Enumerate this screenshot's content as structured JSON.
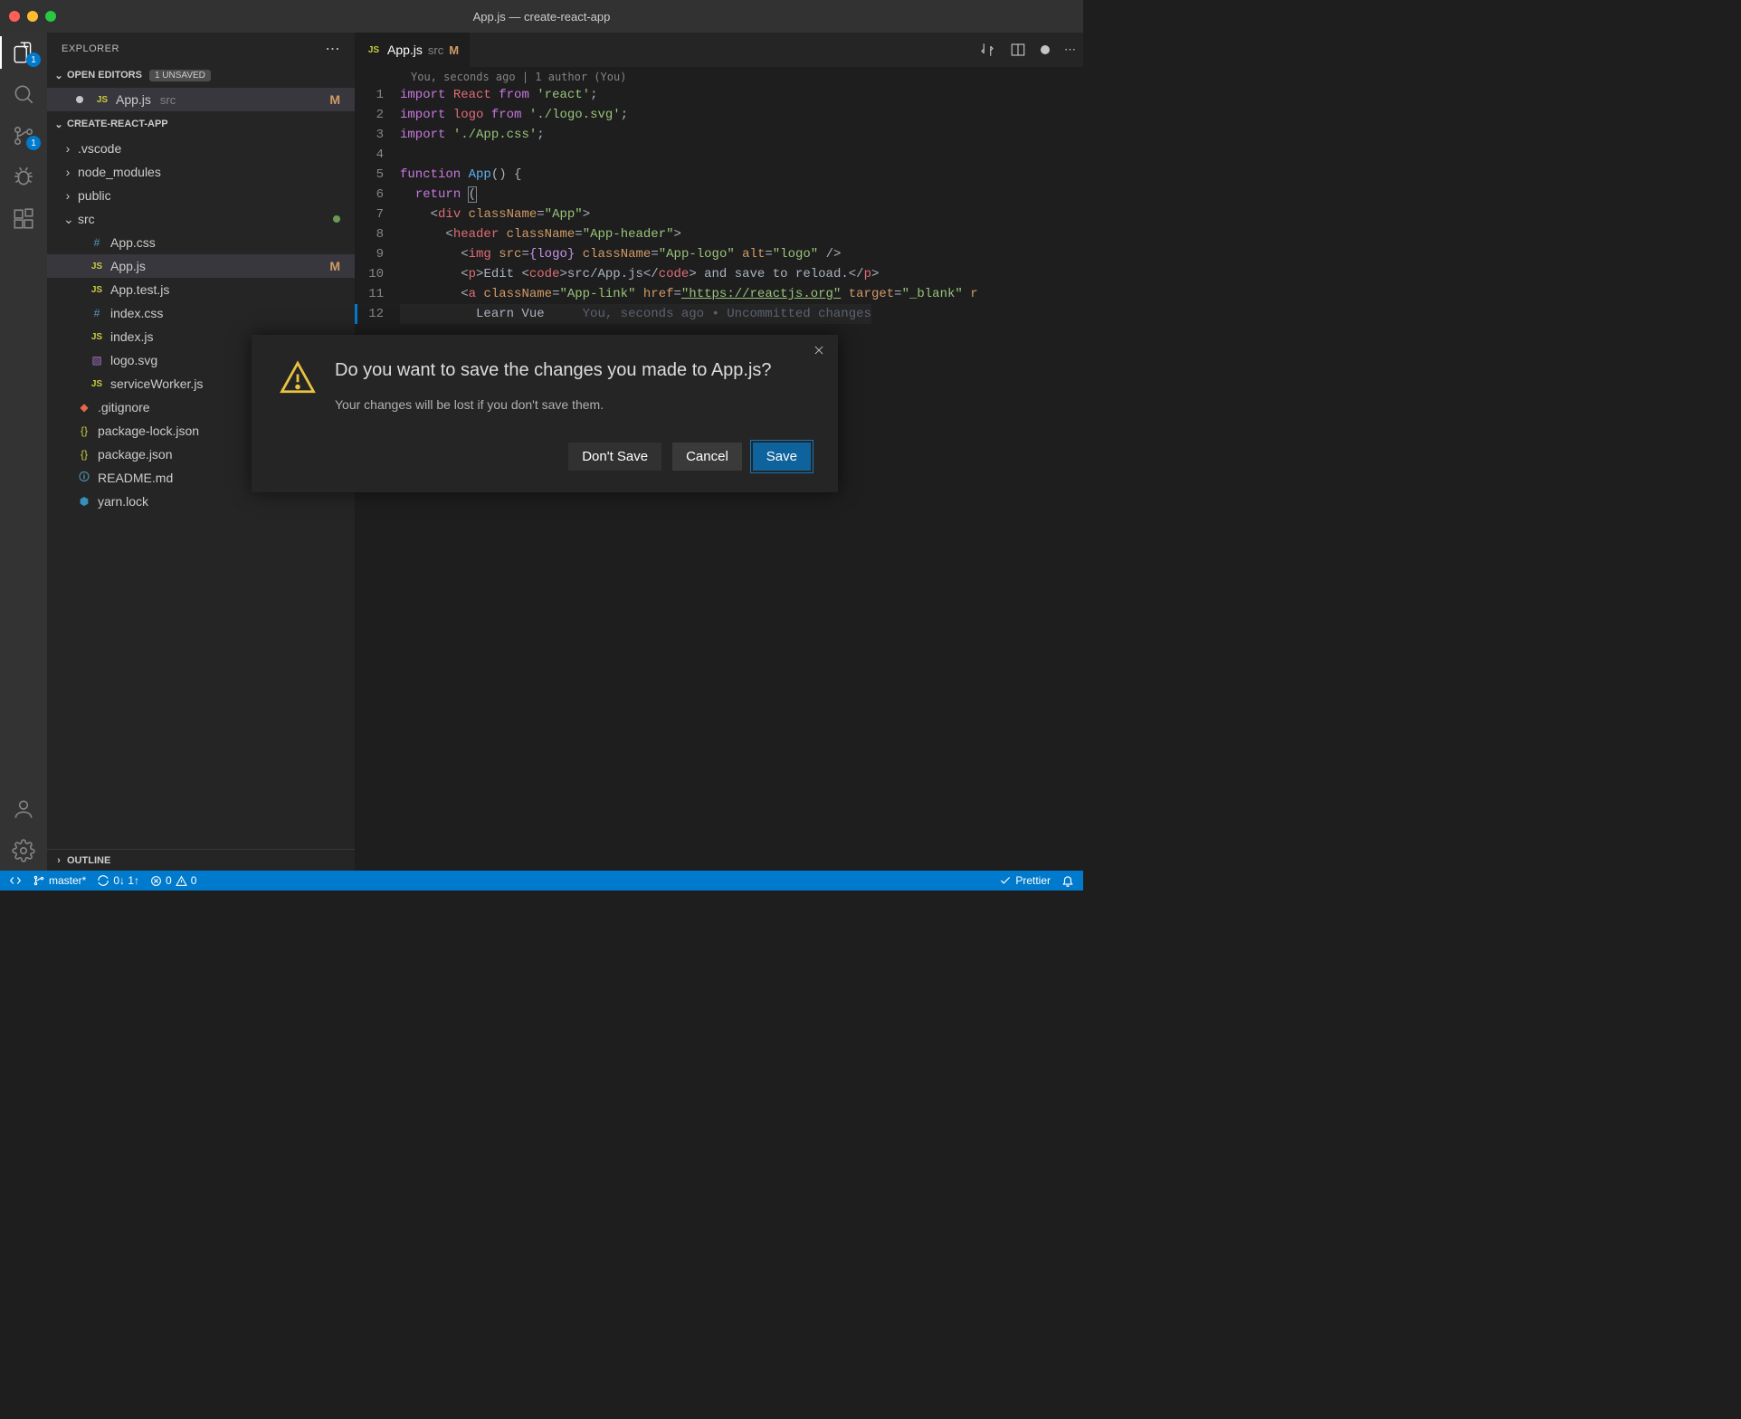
{
  "window": {
    "title": "App.js — create-react-app"
  },
  "activity": {
    "explorer_badge": "1",
    "scm_badge": "1"
  },
  "sidebar": {
    "title": "EXPLORER",
    "openEditors": {
      "label": "OPEN EDITORS",
      "unsaved": "1 UNSAVED",
      "items": [
        {
          "name": "App.js",
          "path": "src",
          "mod": "M",
          "dirty": true,
          "icon": "js"
        }
      ]
    },
    "project": {
      "label": "CREATE-REACT-APP",
      "tree": [
        {
          "type": "folder",
          "name": ".vscode",
          "expanded": false,
          "indent": 1
        },
        {
          "type": "folder",
          "name": "node_modules",
          "expanded": false,
          "indent": 1
        },
        {
          "type": "folder",
          "name": "public",
          "expanded": false,
          "indent": 1
        },
        {
          "type": "folder",
          "name": "src",
          "expanded": true,
          "indent": 1,
          "untracked": true
        },
        {
          "type": "file",
          "name": "App.css",
          "icon": "css",
          "indent": 2
        },
        {
          "type": "file",
          "name": "App.js",
          "icon": "js",
          "indent": 2,
          "active": true,
          "mod": "M"
        },
        {
          "type": "file",
          "name": "App.test.js",
          "icon": "js",
          "indent": 2
        },
        {
          "type": "file",
          "name": "index.css",
          "icon": "css",
          "indent": 2
        },
        {
          "type": "file",
          "name": "index.js",
          "icon": "js",
          "indent": 2
        },
        {
          "type": "file",
          "name": "logo.svg",
          "icon": "svg",
          "indent": 2
        },
        {
          "type": "file",
          "name": "serviceWorker.js",
          "icon": "js",
          "indent": 2
        },
        {
          "type": "file",
          "name": ".gitignore",
          "icon": "git",
          "indent": 1
        },
        {
          "type": "file",
          "name": "package-lock.json",
          "icon": "json",
          "indent": 1
        },
        {
          "type": "file",
          "name": "package.json",
          "icon": "json",
          "indent": 1
        },
        {
          "type": "file",
          "name": "README.md",
          "icon": "md",
          "indent": 1
        },
        {
          "type": "file",
          "name": "yarn.lock",
          "icon": "yarn",
          "indent": 1
        }
      ]
    },
    "outline": {
      "label": "OUTLINE"
    }
  },
  "editor": {
    "tab": {
      "icon": "js",
      "name": "App.js",
      "path": "src",
      "mod": "M"
    },
    "codelens": "You, seconds ago | 1 author (You)",
    "blame": "You, seconds ago • Uncommitted changes",
    "code": {
      "l1_import": "import",
      "l1_react": "React",
      "l1_from": "from",
      "l1_str": "'react'",
      "l2_import": "import",
      "l2_logo": "logo",
      "l2_from": "from",
      "l2_str": "'./logo.svg'",
      "l3_import": "import",
      "l3_str": "'./App.css'",
      "l5_fn": "function",
      "l5_name": "App",
      "l5_paren": "() {",
      "l6_ret": "return",
      "l6_paren": "(",
      "l7_div": "div",
      "l7_cn": "className",
      "l7_val": "\"App\"",
      "l8_hdr": "header",
      "l8_cn": "className",
      "l8_val": "\"App-header\"",
      "l9_img": "img",
      "l9_src": "src",
      "l9_srcv": "{logo}",
      "l9_cn": "className",
      "l9_cnv": "\"App-logo\"",
      "l9_alt": "alt",
      "l9_altv": "\"logo\"",
      "l10_p": "p",
      "l10_edit": "Edit ",
      "l10_code": "code",
      "l10_path": "src/App.js",
      "l10_rest": " and save to reload.",
      "l11_a": "a",
      "l11_cn": "className",
      "l11_cnv": "\"App-link\"",
      "l11_href": "href",
      "l11_hrefv": "\"https://reactjs.org\"",
      "l11_target": "target",
      "l11_targetv": "\"_blank\"",
      "l11_rel": "r",
      "l12_txt": "Learn Vue"
    },
    "lineNumbers": [
      "1",
      "2",
      "3",
      "4",
      "5",
      "6",
      "7",
      "8",
      "9",
      "10",
      "11",
      "12"
    ]
  },
  "dialog": {
    "title": "Do you want to save the changes you made to App.js?",
    "subtitle": "Your changes will be lost if you don't save them.",
    "buttons": {
      "dontSave": "Don't Save",
      "cancel": "Cancel",
      "save": "Save"
    }
  },
  "statusbar": {
    "branch": "master*",
    "sync": "0↓ 1↑",
    "errors": "0",
    "warnings": "0",
    "prettier": "Prettier"
  }
}
